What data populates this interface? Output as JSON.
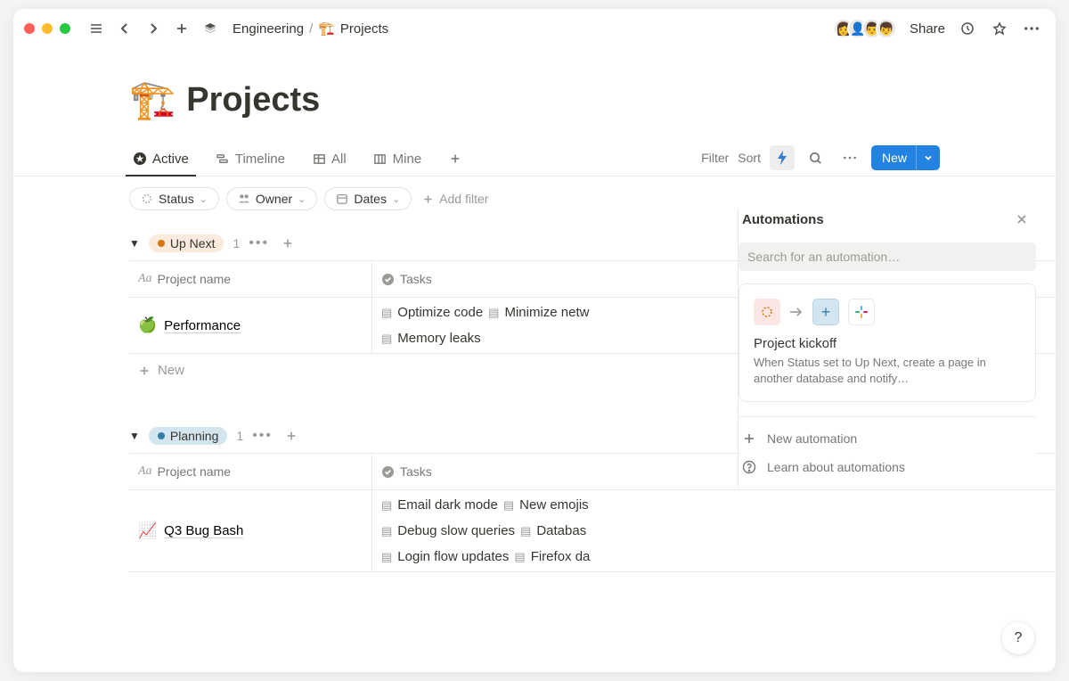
{
  "breadcrumb": {
    "root": "Engineering",
    "page": "Projects",
    "page_icon": "🏗️"
  },
  "topbar": {
    "share": "Share"
  },
  "title": {
    "icon": "🏗️",
    "text": "Projects"
  },
  "tabs": [
    {
      "label": "Active",
      "icon": "star"
    },
    {
      "label": "Timeline",
      "icon": "timeline"
    },
    {
      "label": "All",
      "icon": "table"
    },
    {
      "label": "Mine",
      "icon": "board"
    }
  ],
  "view_controls": {
    "filter": "Filter",
    "sort": "Sort",
    "new_btn": "New"
  },
  "filters": {
    "status": "Status",
    "owner": "Owner",
    "dates": "Dates",
    "add": "Add filter"
  },
  "columns": {
    "name": "Project name",
    "tasks": "Tasks"
  },
  "new_row": "New",
  "groups": [
    {
      "name": "Up Next",
      "count": "1",
      "color": "orange",
      "rows": [
        {
          "icon": "🍏",
          "name": "Performance",
          "tasks": [
            "Optimize code",
            "Minimize netw",
            "Memory leaks"
          ]
        }
      ]
    },
    {
      "name": "Planning",
      "count": "1",
      "color": "blue",
      "rows": [
        {
          "icon": "📈",
          "name": "Q3 Bug Bash",
          "tasks": [
            "Email dark mode",
            "New emojis",
            "Debug slow queries",
            "Databas",
            "Login flow updates",
            "Firefox da"
          ]
        }
      ]
    }
  ],
  "automations": {
    "title": "Automations",
    "search_placeholder": "Search for an automation…",
    "card": {
      "title": "Project kickoff",
      "desc": "When Status set to Up Next, create a page in another database and notify…"
    },
    "new": "New automation",
    "learn": "Learn about automations"
  },
  "help_fab": "?"
}
